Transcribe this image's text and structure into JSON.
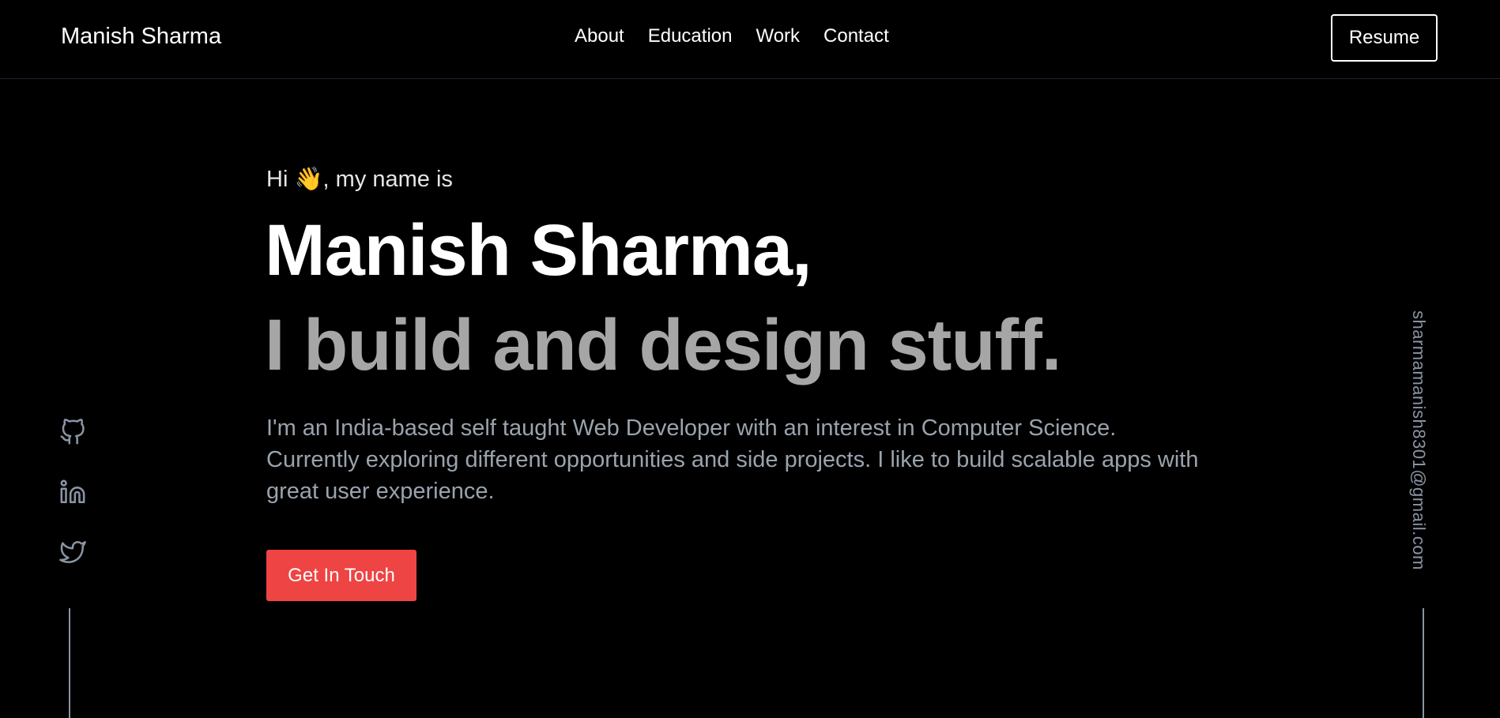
{
  "header": {
    "brand": "Manish Sharma",
    "nav": [
      "About",
      "Education",
      "Work",
      "Contact"
    ],
    "resume_label": "Resume"
  },
  "hero": {
    "greeting": "Hi 👋, my name is",
    "name": "Manish Sharma,",
    "tagline": "I build and design stuff.",
    "description": "I'm an India-based self taught Web Developer with an interest in Computer Science. Currently exploring different opportunities and side projects. I like to build scalable apps with great user experience.",
    "cta_label": "Get In Touch"
  },
  "social": {
    "icons": [
      "github-icon",
      "linkedin-icon",
      "twitter-icon"
    ]
  },
  "email": "sharmamanish8301@gmail.com",
  "colors": {
    "background": "#000000",
    "accent": "#ef4444",
    "muted_text": "#9aa3ad",
    "tagline": "#a6a6a6",
    "rail": "#8a94a3"
  }
}
